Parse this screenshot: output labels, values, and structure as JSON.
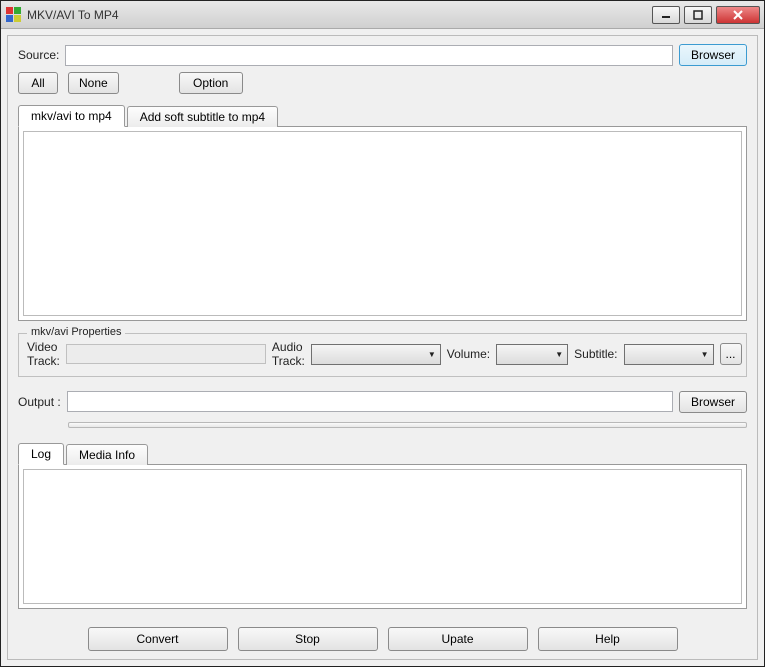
{
  "window": {
    "title": "MKV/AVI To MP4"
  },
  "source": {
    "label": "Source:",
    "value": "",
    "browse": "Browser"
  },
  "buttons": {
    "all": "All",
    "none": "None",
    "option": "Option"
  },
  "tabs_main": {
    "convert": "mkv/avi to mp4",
    "subtitle": "Add soft subtitle to mp4"
  },
  "props": {
    "legend": "mkv/avi Properties",
    "video_track_label": "Video Track:",
    "video_track_value": "",
    "audio_track_label": "Audio Track:",
    "volume_label": "Volume:",
    "subtitle_label": "Subtitle:"
  },
  "output": {
    "label": "Output :",
    "value": "",
    "browse": "Browser"
  },
  "tabs_log": {
    "log": "Log",
    "media": "Media Info"
  },
  "bottom": {
    "convert": "Convert",
    "stop": "Stop",
    "update": "Upate",
    "help": "Help"
  }
}
